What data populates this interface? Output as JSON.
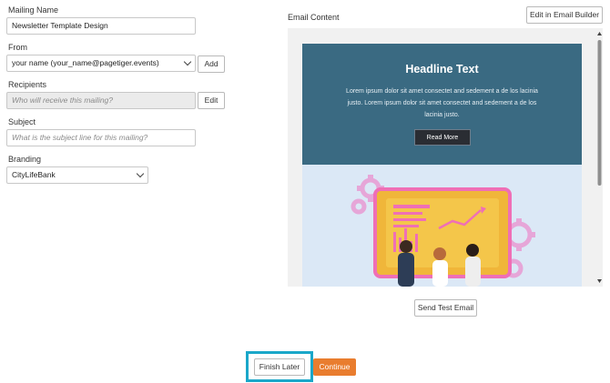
{
  "form": {
    "mailing_name": {
      "label": "Mailing Name",
      "value": "Newsletter Template Design"
    },
    "from": {
      "label": "From",
      "value": "your name (your_name@pagetiger.events)",
      "add_button": "Add"
    },
    "recipients": {
      "label": "Recipients",
      "placeholder": "Who will receive this mailing?",
      "edit_button": "Edit"
    },
    "subject": {
      "label": "Subject",
      "placeholder": "What is the subject line for this mailing?"
    },
    "branding": {
      "label": "Branding",
      "value": "CityLifeBank"
    }
  },
  "email_content": {
    "label": "Email Content",
    "edit_builder_button": "Edit in Email Builder",
    "headline": "Headline Text",
    "body": "Lorem ipsum dolor sit amet consectet and sedement a de los lacinia justo. Lorem ipsum dolor sit amet consectet and sedement a de los lacinia justo.",
    "read_more": "Read More",
    "send_test_button": "Send Test Email"
  },
  "footer": {
    "finish_later": "Finish Later",
    "continue": "Continue"
  },
  "colors": {
    "accent": "#e97d2f",
    "highlight": "#1aa7c9",
    "hero": "#3a6a82"
  }
}
